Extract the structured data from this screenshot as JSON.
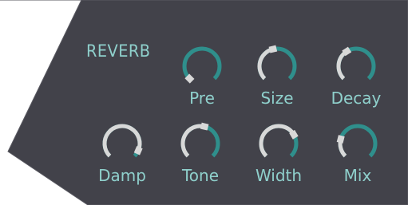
{
  "plugin": {
    "section_title": "REVERB",
    "colors": {
      "panel": "#42424a",
      "panel_edge": "#5a5a62",
      "accent": "#2f8f8c",
      "label": "#8fd0cc",
      "pointer": "#d8d8d8"
    },
    "knobs": [
      {
        "id": "pre",
        "label": "Pre",
        "value": 0.0
      },
      {
        "id": "size",
        "label": "Size",
        "value": 0.45
      },
      {
        "id": "decay",
        "label": "Decay",
        "value": 0.38
      },
      {
        "id": "damp",
        "label": "Damp",
        "value": 0.92
      },
      {
        "id": "tone",
        "label": "Tone",
        "value": 0.55
      },
      {
        "id": "width",
        "label": "Width",
        "value": 0.72
      },
      {
        "id": "mix",
        "label": "Mix",
        "value": 0.22
      }
    ]
  }
}
